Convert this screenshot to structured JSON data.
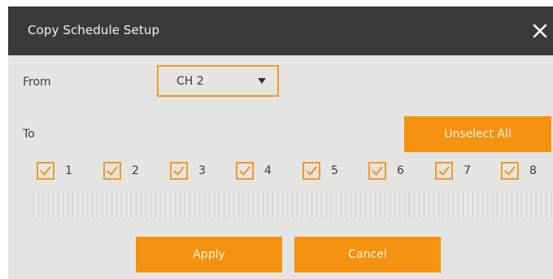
{
  "dialog": {
    "title": "Copy Schedule Setup",
    "close_icon": "close-icon"
  },
  "from": {
    "label": "From",
    "selected": "CH 2"
  },
  "to": {
    "label": "To"
  },
  "buttons": {
    "unselect_all": "Unselect All",
    "apply": "Apply",
    "cancel": "Cancel"
  },
  "channels": [
    {
      "label": "1",
      "checked": true
    },
    {
      "label": "2",
      "checked": true
    },
    {
      "label": "3",
      "checked": true
    },
    {
      "label": "4",
      "checked": true
    },
    {
      "label": "5",
      "checked": true
    },
    {
      "label": "6",
      "checked": true
    },
    {
      "label": "7",
      "checked": true
    },
    {
      "label": "8",
      "checked": true
    }
  ],
  "colors": {
    "accent": "#f5920f",
    "title_bar": "#3a3a3a",
    "panel": "#e4e4e2"
  }
}
